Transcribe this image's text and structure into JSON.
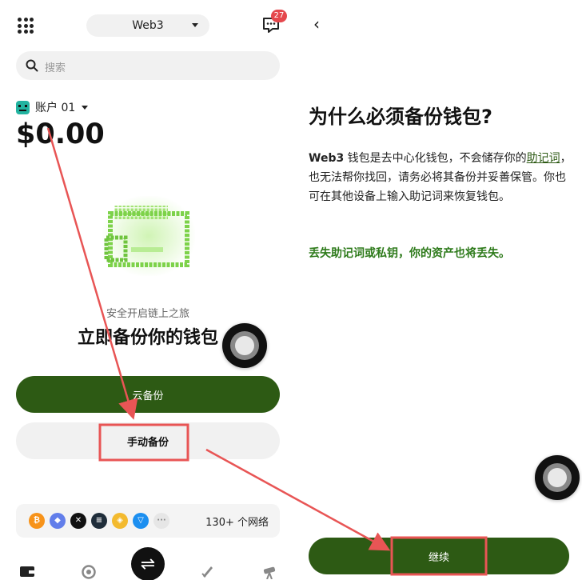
{
  "left": {
    "network_selector": "Web3",
    "message_badge": "27",
    "search_placeholder": "搜索",
    "account_name": "账户 01",
    "balance": "$0.00",
    "subtitle": "安全开启链上之旅",
    "headline": "立即备份你的钱包",
    "cloud_backup_label": "云备份",
    "manual_backup_label": "手动备份",
    "networks": {
      "coins": [
        {
          "symbol": "₿",
          "color": "#f7931a"
        },
        {
          "symbol": "◆",
          "color": "#627eea"
        },
        {
          "symbol": "✕",
          "color": "#111111"
        },
        {
          "symbol": "≡",
          "color": "#1f2d3a"
        },
        {
          "symbol": "◈",
          "color": "#f3ba2f"
        },
        {
          "symbol": "▽",
          "color": "#1c8ff0"
        },
        {
          "symbol": "···",
          "color": "#e6e6e6"
        }
      ],
      "count_label": "130+ 个网络"
    },
    "tabbar": [
      "wallet-icon",
      "discover-icon",
      "swap-icon",
      "rocket-icon",
      "telescope-icon"
    ]
  },
  "right": {
    "title": "为什么必须备份钱包?",
    "body_part1_bold": "Web3",
    "body_part1": " 钱包是去中心化钱包，不会储存你的",
    "body_link": "助记词",
    "body_part2": "，也无法帮你找回，请务必将其备份并妥善保管。你也可在其他设备上输入助记词来恢复钱包。",
    "warning": "丢失助记词或私钥，你的资产也将丢失。",
    "continue_label": "继续"
  },
  "colors": {
    "brand_green": "#2d5a14",
    "warning_green": "#2d7a1a",
    "annotation_red": "#e85555"
  }
}
